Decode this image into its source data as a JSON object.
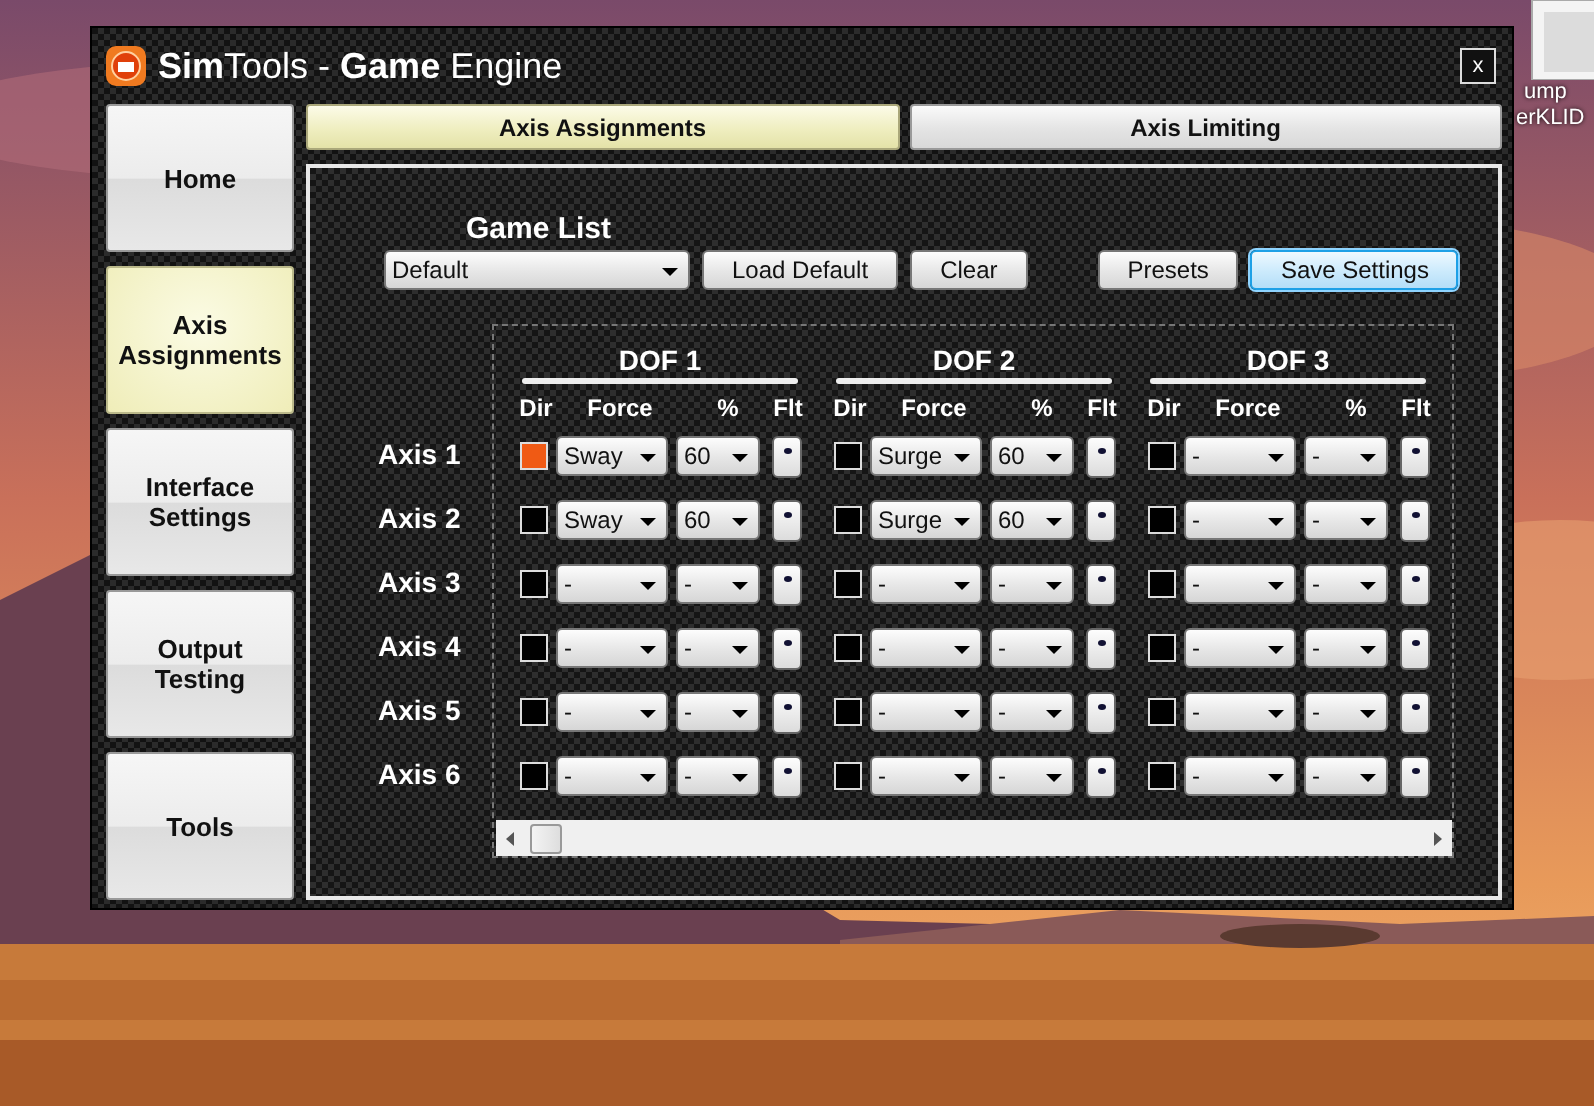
{
  "window": {
    "title": "**Sim**Tools - **Game** Engine",
    "close_label": "x"
  },
  "desktop_icon_label": [
    "ump",
    "erKLID"
  ],
  "sidebar": [
    {
      "label": "Home",
      "selected": false
    },
    {
      "label": "Axis Assignments",
      "selected": true
    },
    {
      "label": "Interface Settings",
      "selected": false
    },
    {
      "label": "Output Testing",
      "selected": false
    },
    {
      "label": "Tools",
      "selected": false
    }
  ],
  "tabs": [
    {
      "label": "Axis Assignments",
      "selected": true
    },
    {
      "label": "Axis Limiting",
      "selected": false
    }
  ],
  "game_list": {
    "label": "Game List",
    "value": "Default"
  },
  "list_buttons": [
    {
      "label": "Load Default",
      "focused": false
    },
    {
      "label": "Clear",
      "focused": false
    }
  ],
  "settings_buttons": [
    {
      "label": "Presets",
      "focused": false
    },
    {
      "label": "Save Settings",
      "focused": true
    }
  ],
  "dofs": [
    {
      "title": "DOF 1",
      "headers": [
        "Dir",
        "Force",
        "%",
        "Flt"
      ]
    },
    {
      "title": "DOF 2",
      "headers": [
        "Dir",
        "Force",
        "%",
        "Flt"
      ]
    },
    {
      "title": "DOF 3",
      "headers": [
        "Dir",
        "Force",
        "%",
        "Flt"
      ]
    }
  ],
  "axes": [
    {
      "label": "Axis 1",
      "dofs": [
        {
          "dir_checked": true,
          "force": "Sway",
          "percent": "60"
        },
        {
          "dir_checked": false,
          "force": "Surge",
          "percent": "60"
        },
        {
          "dir_checked": false,
          "force": "-",
          "percent": "-"
        }
      ]
    },
    {
      "label": "Axis 2",
      "dofs": [
        {
          "dir_checked": false,
          "force": "Sway",
          "percent": "60"
        },
        {
          "dir_checked": false,
          "force": "Surge",
          "percent": "60"
        },
        {
          "dir_checked": false,
          "force": "-",
          "percent": "-"
        }
      ]
    },
    {
      "label": "Axis 3",
      "dofs": [
        {
          "dir_checked": false,
          "force": "-",
          "percent": "-"
        },
        {
          "dir_checked": false,
          "force": "-",
          "percent": "-"
        },
        {
          "dir_checked": false,
          "force": "-",
          "percent": "-"
        }
      ]
    },
    {
      "label": "Axis 4",
      "dofs": [
        {
          "dir_checked": false,
          "force": "-",
          "percent": "-"
        },
        {
          "dir_checked": false,
          "force": "-",
          "percent": "-"
        },
        {
          "dir_checked": false,
          "force": "-",
          "percent": "-"
        }
      ]
    },
    {
      "label": "Axis 5",
      "dofs": [
        {
          "dir_checked": false,
          "force": "-",
          "percent": "-"
        },
        {
          "dir_checked": false,
          "force": "-",
          "percent": "-"
        },
        {
          "dir_checked": false,
          "force": "-",
          "percent": "-"
        }
      ]
    },
    {
      "label": "Axis 6",
      "dofs": [
        {
          "dir_checked": false,
          "force": "-",
          "percent": "-"
        },
        {
          "dir_checked": false,
          "force": "-",
          "percent": "-"
        },
        {
          "dir_checked": false,
          "force": "-",
          "percent": "-"
        }
      ]
    }
  ]
}
